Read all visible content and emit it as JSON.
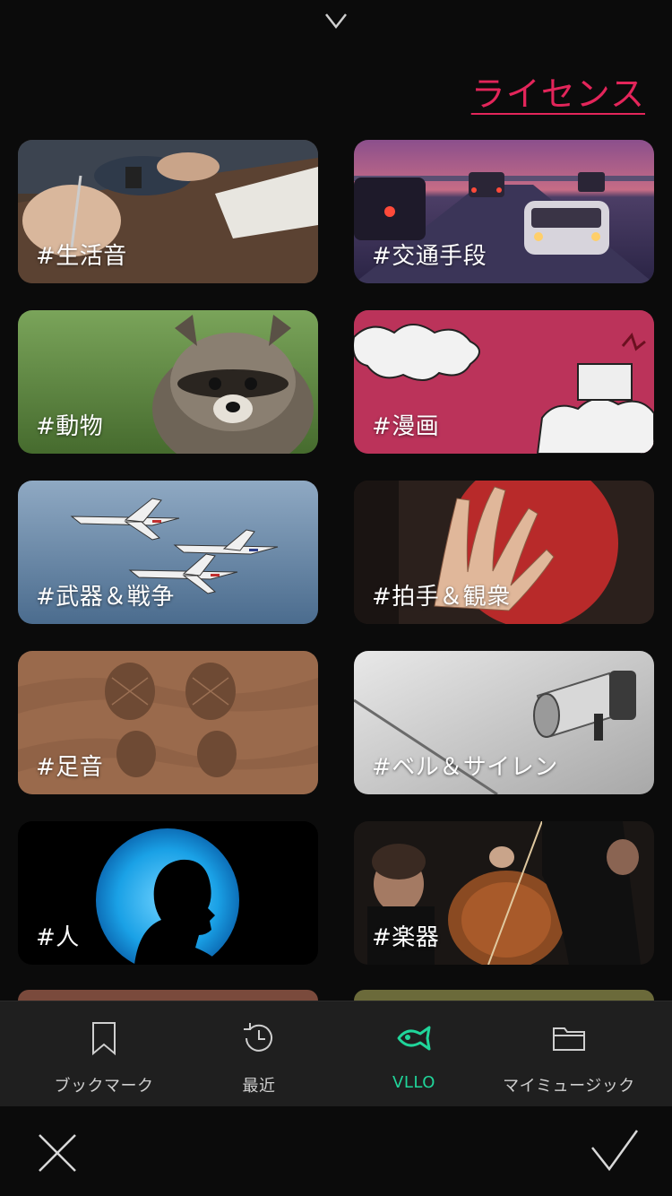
{
  "header": {
    "license_label": "ライセンス"
  },
  "categories": [
    {
      "label": "#生活音",
      "theme": "desk-hands"
    },
    {
      "label": "#交通手段",
      "theme": "highway-traffic"
    },
    {
      "label": "#動物",
      "theme": "raccoon"
    },
    {
      "label": "#漫画",
      "theme": "comic-clouds"
    },
    {
      "label": "#武器＆戦争",
      "theme": "jets"
    },
    {
      "label": "#拍手＆観衆",
      "theme": "hands-clap"
    },
    {
      "label": "#足音",
      "theme": "footprints-sand"
    },
    {
      "label": "#ベル＆サイレン",
      "theme": "megaphone"
    },
    {
      "label": "#人",
      "theme": "silhouette"
    },
    {
      "label": "#楽器",
      "theme": "orchestra-cello"
    }
  ],
  "tabs": [
    {
      "label": "ブックマーク",
      "icon": "bookmark-icon",
      "active": false
    },
    {
      "label": "最近",
      "icon": "history-clock-icon",
      "active": false
    },
    {
      "label": "VLLO",
      "icon": "vllo-fish-icon",
      "active": true
    },
    {
      "label": "マイミュージック",
      "icon": "folder-icon",
      "active": false
    }
  ],
  "colors": {
    "background": "#0b0b0b",
    "accent_license": "#e3255a",
    "accent_active_tab": "#20d59a",
    "tab_bar": "#1f1f1f"
  }
}
